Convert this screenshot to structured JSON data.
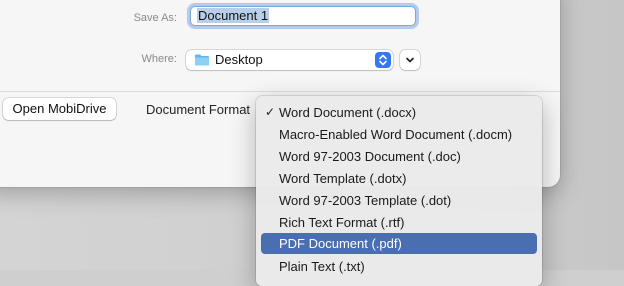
{
  "save_dialog": {
    "save_as_label": "Save As:",
    "file_name": "Document 1",
    "where_label": "Where:",
    "where_value": "Desktop",
    "open_mobidrive_label": "Open MobiDrive",
    "document_format_label": "Document Format"
  },
  "format_menu": {
    "items": [
      {
        "label": "Word Document (.docx)",
        "checked": "✓"
      },
      {
        "label": "Macro-Enabled Word Document (.docm)",
        "checked": ""
      },
      {
        "label": "Word 97-2003 Document (.doc)",
        "checked": ""
      },
      {
        "label": "Word Template (.dotx)",
        "checked": ""
      },
      {
        "label": "Word 97-2003 Template (.dot)",
        "checked": ""
      },
      {
        "label": "Rich Text Format (.rtf)",
        "checked": ""
      },
      {
        "label": "PDF Document (.pdf)",
        "checked": ""
      },
      {
        "label": "Plain Text (.txt)",
        "checked": ""
      }
    ],
    "highlighted_item": "PDF Document (.pdf)"
  },
  "colors": {
    "accent": "#3478f6",
    "menu_highlight": "#4a6fb0",
    "selection": "#b9cfe9"
  },
  "icons": {
    "folder": "folder-icon",
    "stepper": "chevron-up-down-icon",
    "expand": "chevron-down-icon",
    "check": "checkmark-icon"
  }
}
